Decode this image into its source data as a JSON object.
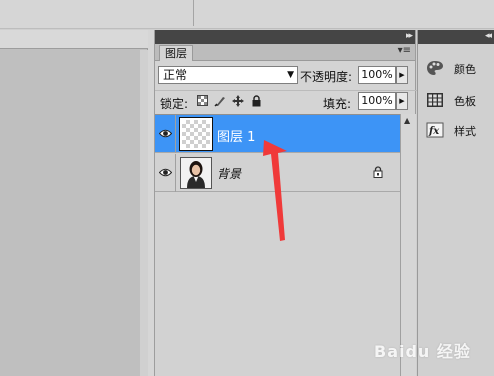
{
  "layers_panel": {
    "tab_label": "图层",
    "blend_mode": "正常",
    "opacity_label": "不透明度:",
    "opacity_value": "100%",
    "lock_label": "锁定:",
    "fill_label": "填充:",
    "fill_value": "100%",
    "layers": [
      {
        "name": "图层 1",
        "selected": true,
        "visible": true,
        "thumbnail": "transparent-checker"
      },
      {
        "name": "背景",
        "selected": false,
        "visible": true,
        "thumbnail": "portrait-photo",
        "locked": true
      }
    ]
  },
  "side_dock": {
    "items": [
      {
        "label": "颜色",
        "icon": "color-palette-icon"
      },
      {
        "label": "色板",
        "icon": "swatches-grid-icon"
      },
      {
        "label": "样式",
        "icon": "styles-fx-icon"
      }
    ]
  },
  "watermark": {
    "text": "Baidu 经验"
  },
  "colors": {
    "selected_layer": "#3d94f6",
    "annotation_arrow": "#f03a3a",
    "panel_bg": "#d4d4d4",
    "dark_bar": "#454545"
  }
}
